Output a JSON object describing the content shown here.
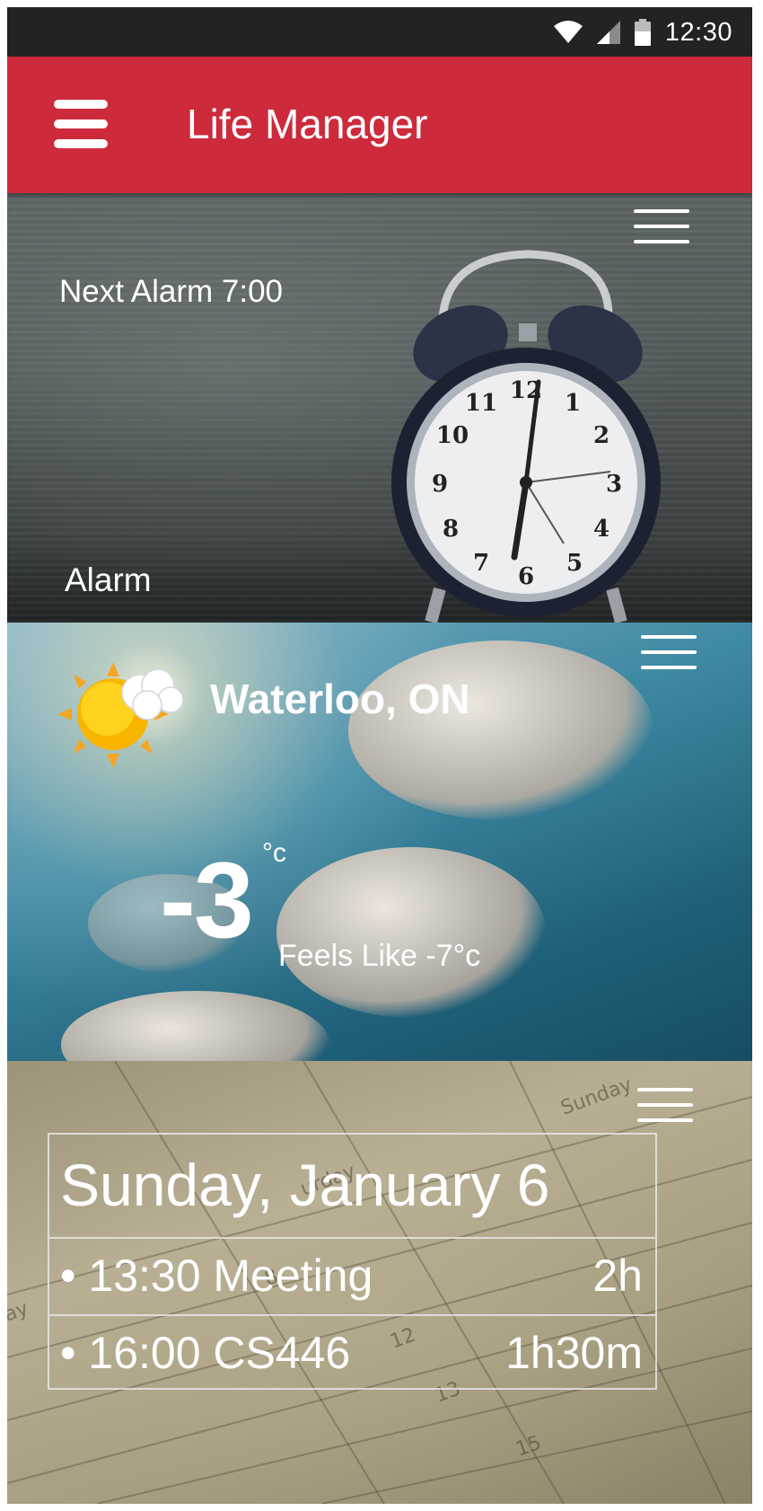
{
  "status_bar": {
    "time": "12:30"
  },
  "app_bar": {
    "title": "Life Manager"
  },
  "alarm": {
    "next_alarm": "Next Alarm 7:00",
    "label": "Alarm"
  },
  "weather": {
    "city": "Waterloo, ON",
    "temperature": "-3",
    "unit": "°c",
    "feels_like": "Feels Like -7°c"
  },
  "calendar": {
    "date": "Sunday, January 6",
    "events": [
      {
        "text": "• 13:30 Meeting",
        "duration": "2h"
      },
      {
        "text": "• 16:00 CS446",
        "duration": "1h30m"
      }
    ]
  },
  "colors": {
    "app_bar": "#cd2a3c",
    "status_bar": "#232323"
  }
}
